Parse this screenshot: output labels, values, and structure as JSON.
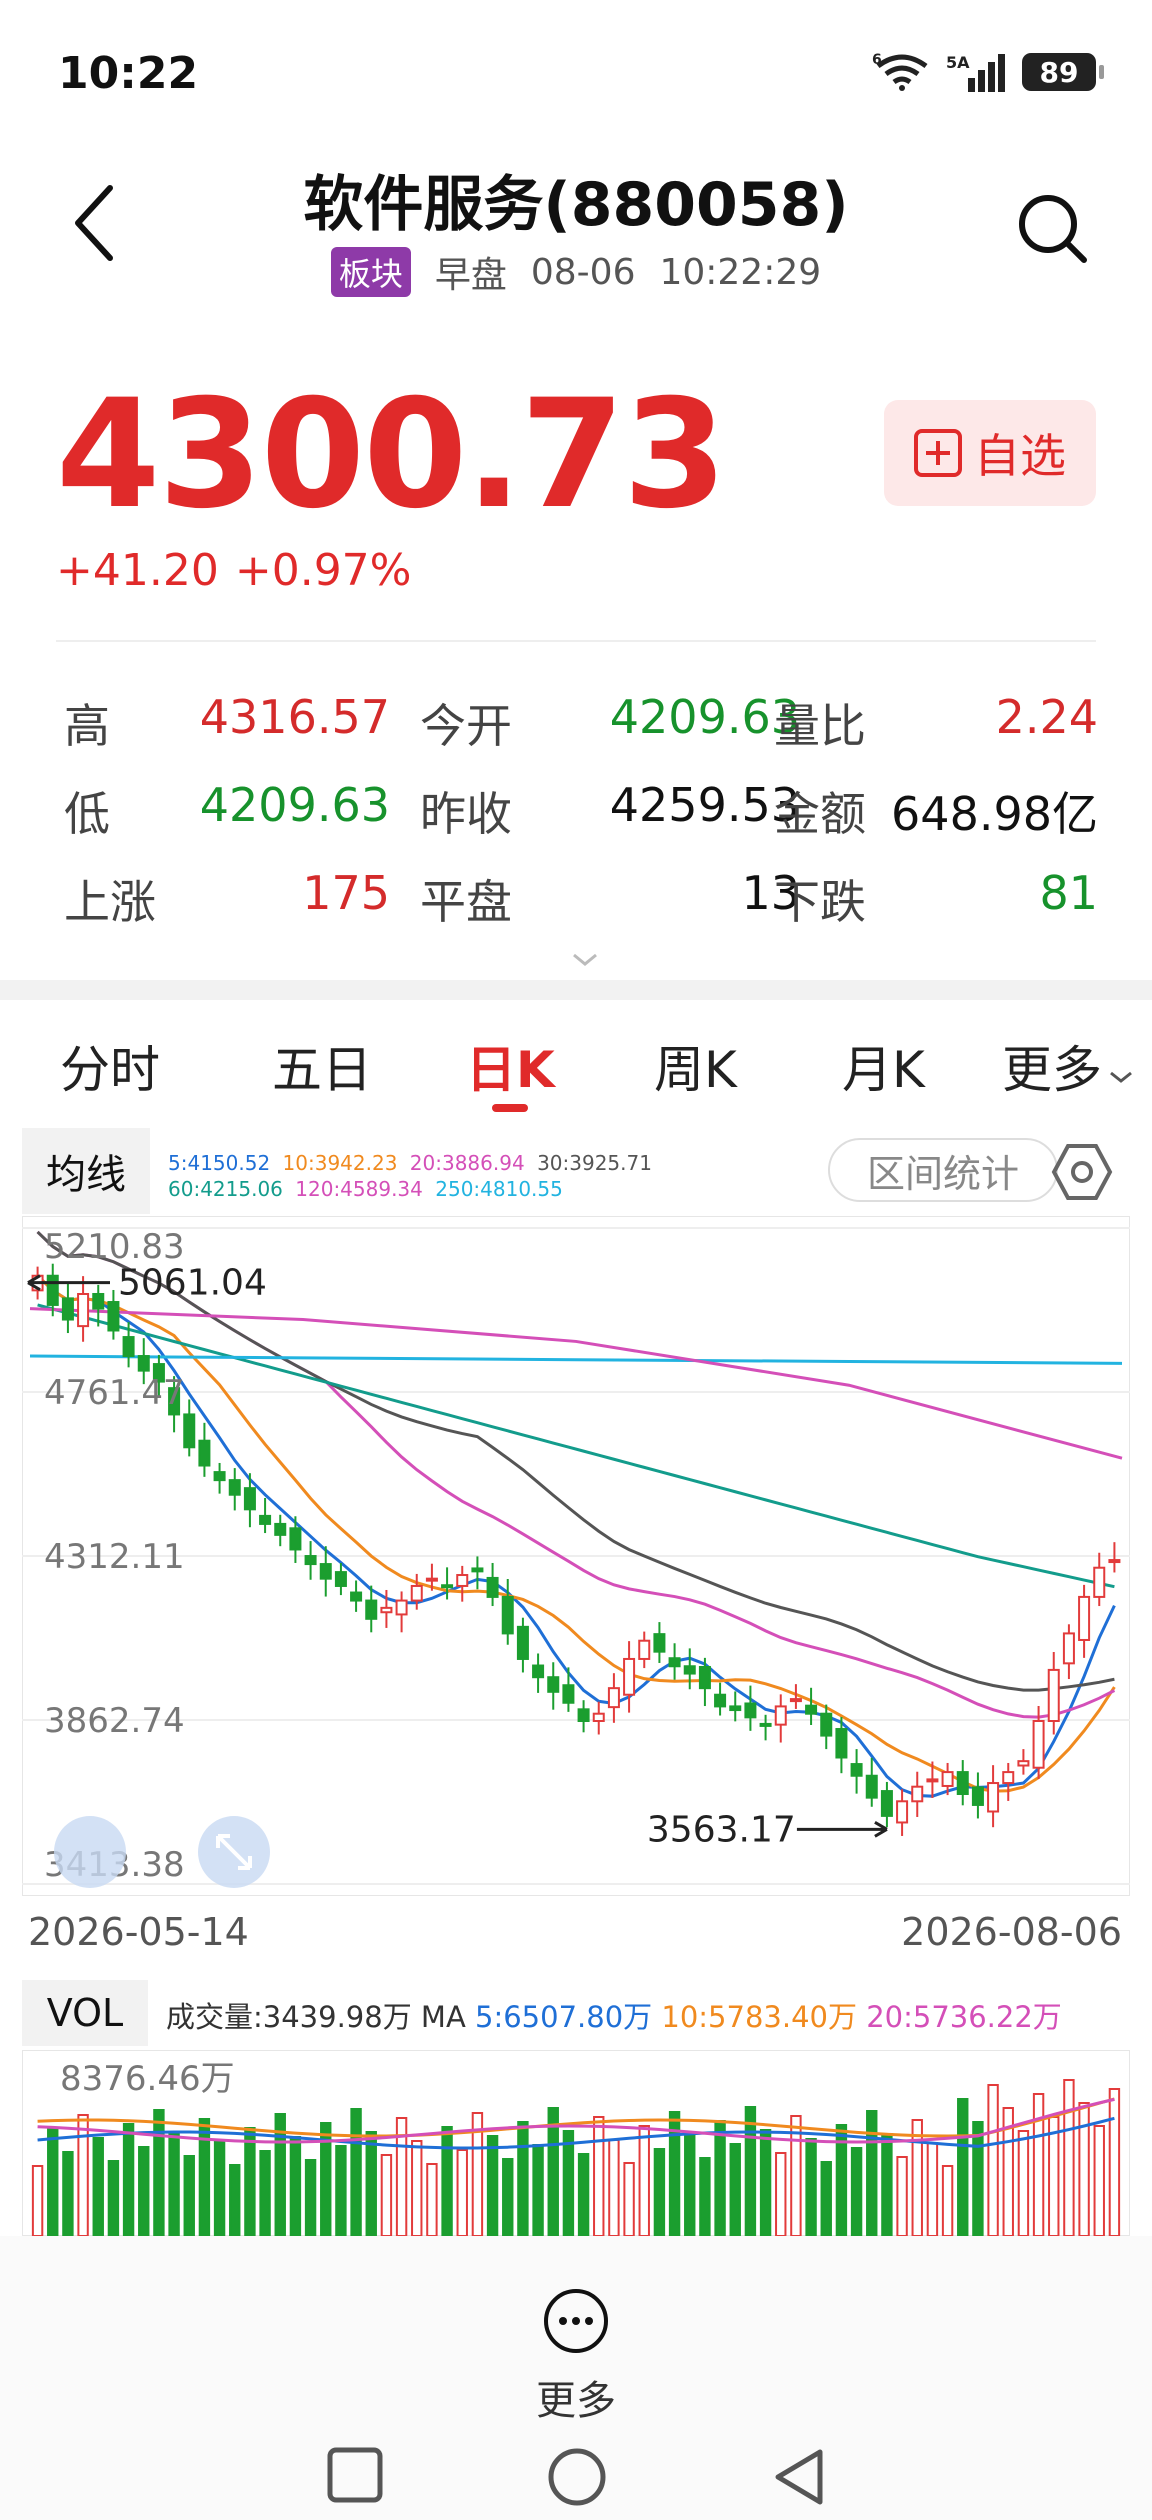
{
  "status": {
    "time": "10:22",
    "network": "5A",
    "wifi": "6",
    "battery": "89"
  },
  "nav": {
    "title": "软件服务(880058)",
    "tag": "板块",
    "session": "早盘",
    "date": "08-06",
    "time": "10:22:29"
  },
  "quote": {
    "price": "4300.73",
    "change": "+41.20",
    "change_pct": "+0.97%",
    "fav_label": "自选"
  },
  "stats": [
    [
      {
        "label": "高",
        "value": "4316.57",
        "color": "red"
      },
      {
        "label": "今开",
        "value": "4209.63",
        "color": "green"
      },
      {
        "label": "量比",
        "value": "2.24",
        "color": "red"
      }
    ],
    [
      {
        "label": "低",
        "value": "4209.63",
        "color": "green"
      },
      {
        "label": "昨收",
        "value": "4259.53",
        "color": "black"
      },
      {
        "label": "金额",
        "value": "648.98亿",
        "color": "black"
      }
    ],
    [
      {
        "label": "上涨",
        "value": "175",
        "color": "red"
      },
      {
        "label": "平盘",
        "value": "13",
        "color": "black"
      },
      {
        "label": "下跌",
        "value": "81",
        "color": "green"
      }
    ]
  ],
  "tabs": [
    "分时",
    "五日",
    "日K",
    "周K",
    "月K",
    "更多"
  ],
  "active_tab": "日K",
  "ma": {
    "label": "均线",
    "legend": [
      {
        "text": "5:4150.52",
        "color": "#1f6fd6"
      },
      {
        "text": "10:3942.23",
        "color": "#f08a1f"
      },
      {
        "text": "20:3886.94",
        "color": "#d44fb8"
      },
      {
        "text": "30:3925.71",
        "color": "#555555"
      },
      {
        "text": "60:4215.06",
        "color": "#139c8c"
      },
      {
        "text": "120:4589.34",
        "color": "#d44fb8"
      },
      {
        "text": "250:4810.55",
        "color": "#22b3e0"
      }
    ],
    "range_button": "区间统计"
  },
  "chart_data": {
    "type": "candlestick",
    "y_ticks": [
      "5210.83",
      "4761.47",
      "4312.11",
      "3862.74",
      "3413.38"
    ],
    "ylim": [
      3413.38,
      5210.83
    ],
    "x_start": "2026-05-14",
    "x_end": "2026-08-06",
    "annotations": {
      "high": "5061.04",
      "low": "3563.17"
    },
    "closes": [
      5080,
      5000,
      4960,
      5030,
      4990,
      4930,
      4860,
      4820,
      4790,
      4700,
      4610,
      4560,
      4520,
      4480,
      4440,
      4400,
      4370,
      4330,
      4290,
      4250,
      4230,
      4190,
      4140,
      4170,
      4190,
      4230,
      4250,
      4230,
      4260,
      4270,
      4200,
      4100,
      4030,
      3980,
      3940,
      3910,
      3860,
      3880,
      3950,
      4030,
      4080,
      4050,
      4010,
      3990,
      3950,
      3900,
      3890,
      3870,
      3850,
      3900,
      3920,
      3880,
      3820,
      3760,
      3710,
      3650,
      3600,
      3640,
      3680,
      3700,
      3720,
      3660,
      3630,
      3690,
      3720,
      3750,
      3860,
      4000,
      4100,
      4200,
      4280,
      4301
    ],
    "ma_series": {
      "250": [
        4860,
        4855,
        4850,
        4845,
        4840
      ],
      "120": [
        4990,
        4960,
        4900,
        4780,
        4580
      ]
    },
    "series_colors": {
      "5": "#1f6fd6",
      "10": "#f08a1f",
      "20": "#d44fb8",
      "30": "#555555",
      "60": "#139c8c",
      "120": "#d44fb8",
      "250": "#22b3e0"
    }
  },
  "vol": {
    "label": "VOL",
    "legend": [
      {
        "text": "成交量:3439.98万",
        "color": "#333333"
      },
      {
        "text": "MA",
        "color": "#333333"
      },
      {
        "text": "5:6507.80万",
        "color": "#1f6fd6"
      },
      {
        "text": "10:5783.40万",
        "color": "#f08a1f"
      },
      {
        "text": "20:5736.22万",
        "color": "#d44fb8"
      }
    ],
    "max_label": "8376.46万"
  },
  "bottom": {
    "more_label": "更多"
  }
}
